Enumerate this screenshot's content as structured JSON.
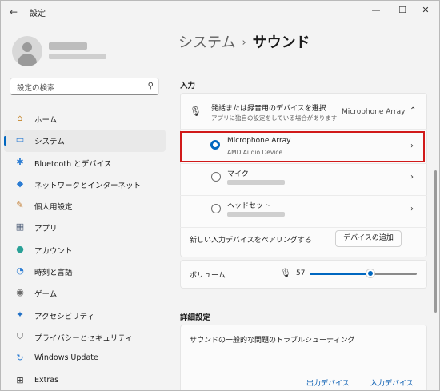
{
  "window": {
    "app_title": "設定",
    "back_glyph": "←",
    "minimize_glyph": "—",
    "maximize_glyph": "☐",
    "close_glyph": "✕"
  },
  "search": {
    "placeholder": "設定の検索",
    "icon": "search-icon"
  },
  "sidebar": {
    "items": [
      {
        "label": "ホーム",
        "icon": "home-icon",
        "glyph": "⌂",
        "color": "#c5862b"
      },
      {
        "label": "システム",
        "icon": "system-icon",
        "glyph": "▭",
        "color": "#2b7cd3",
        "active": true
      },
      {
        "label": "Bluetooth とデバイス",
        "icon": "bluetooth-icon",
        "glyph": "✱",
        "color": "#2b7cd3"
      },
      {
        "label": "ネットワークとインターネット",
        "icon": "network-icon",
        "glyph": "◆",
        "color": "#2b7cd3"
      },
      {
        "label": "個人用設定",
        "icon": "brush-icon",
        "glyph": "✎",
        "color": "#c27a2d"
      },
      {
        "label": "アプリ",
        "icon": "apps-icon",
        "glyph": "▦",
        "color": "#4a5a75"
      },
      {
        "label": "アカウント",
        "icon": "account-icon",
        "glyph": "●",
        "color": "#2aa197"
      },
      {
        "label": "時刻と言語",
        "icon": "time-language-icon",
        "glyph": "◔",
        "color": "#2b7cd3"
      },
      {
        "label": "ゲーム",
        "icon": "gaming-icon",
        "glyph": "◉",
        "color": "#6a6a6a"
      },
      {
        "label": "アクセシビリティ",
        "icon": "accessibility-icon",
        "glyph": "✦",
        "color": "#1f6fc5"
      },
      {
        "label": "プライバシーとセキュリティ",
        "icon": "shield-icon",
        "glyph": "⛉",
        "color": "#6a6a6a"
      },
      {
        "label": "Windows Update",
        "icon": "windows-update-icon",
        "glyph": "↻",
        "color": "#2b7cd3"
      },
      {
        "label": "Extras",
        "icon": "extras-icon",
        "glyph": "⊞",
        "color": "#333333"
      }
    ]
  },
  "breadcrumb": {
    "parent": "システム",
    "separator": "›",
    "current": "サウンド"
  },
  "input_section": {
    "title": "入力",
    "selector_title": "発話または録音用のデバイスを選択",
    "selector_sub": "アプリに独自の設定をしている場合があります",
    "selected_device": "Microphone Array",
    "devices": [
      {
        "name": "Microphone Array",
        "sub": "AMD Audio Device",
        "selected": true
      },
      {
        "name": "マイク",
        "sub": "",
        "selected": false
      },
      {
        "name": "ヘッドセット",
        "sub": "",
        "selected": false
      }
    ],
    "pair_text": "新しい入力デバイスをペアリングする",
    "add_device_button": "デバイスの追加",
    "volume_label": "ボリューム",
    "volume_value": "57"
  },
  "advanced": {
    "title": "詳細設定",
    "troubleshoot": "サウンドの一般的な問題のトラブルシューティング",
    "output_link": "出力デバイス",
    "input_link": "入力デバイス"
  }
}
